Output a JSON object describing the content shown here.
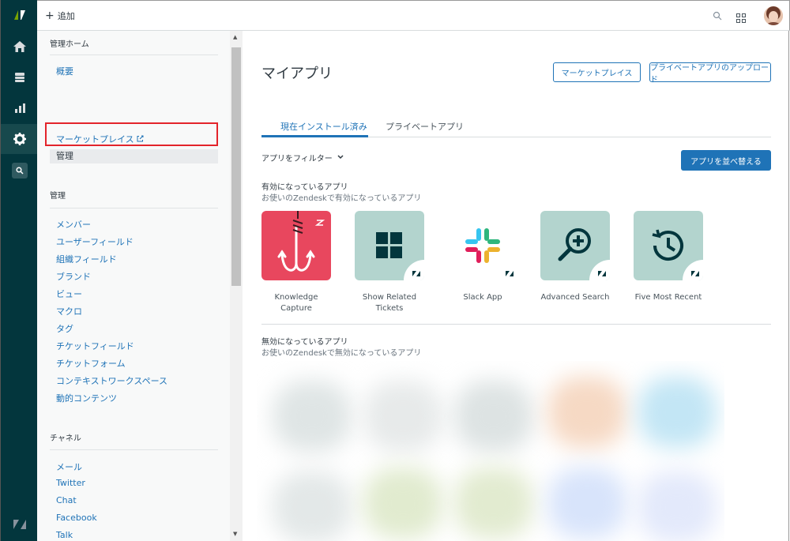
{
  "topbar": {
    "add_label": "追加",
    "icons": [
      "search-icon",
      "apps-grid-icon",
      "user-avatar"
    ]
  },
  "rail": {
    "icons": [
      "zendesk-logo-icon",
      "home-icon",
      "views-icon",
      "reporting-icon",
      "admin-gear-icon",
      "search-icon",
      "zendesk-z-icon"
    ]
  },
  "sidenav": {
    "home_title": "管理ホーム",
    "home_items": [
      "概要"
    ],
    "marketplace_label": "マーケットプレイス",
    "admin_selected": "管理",
    "manage_title": "管理",
    "manage_items": [
      "メンバー",
      "ユーザーフィールド",
      "組織フィールド",
      "ブランド",
      "ビュー",
      "マクロ",
      "タグ",
      "チケットフィールド",
      "チケットフォーム",
      "コンテキストワークスペース",
      "動的コンテンツ"
    ],
    "channel_title": "チャネル",
    "channel_items": [
      "メール",
      "Twitter",
      "Chat",
      "Facebook",
      "Talk"
    ]
  },
  "main": {
    "title": "マイアプリ",
    "marketplace_button": "マーケットプレイス",
    "upload_button": "プライベートアプリのアップロード",
    "tabs": [
      "現在インストール済み",
      "プライベートアプリ"
    ],
    "filter_label": "アプリをフィルター",
    "reorder_button": "アプリを並べ替える",
    "enabled_title": "有効になっているアプリ",
    "enabled_sub": "お使いのZendeskで有効になっているアプリ",
    "disabled_title": "無効になっているアプリ",
    "disabled_sub": "お使いのZendeskで無効になっているアプリ",
    "apps": [
      {
        "name_line1": "Knowledge",
        "name_line2": "Capture",
        "color": "#e8475e"
      },
      {
        "name_line1": "Show Related",
        "name_line2": "Tickets",
        "color": "#b3d4ce"
      },
      {
        "name_line1": "Slack App",
        "name_line2": "",
        "color": "#ffffff"
      },
      {
        "name_line1": "Advanced Search",
        "name_line2": "",
        "color": "#b3d4ce"
      },
      {
        "name_line1": "Five Most Recent",
        "name_line2": "",
        "color": "#b3d4ce"
      }
    ]
  },
  "colors": {
    "rail": "#03363d",
    "accent": "#1f73b7",
    "highlight_box": "#e3242b"
  }
}
